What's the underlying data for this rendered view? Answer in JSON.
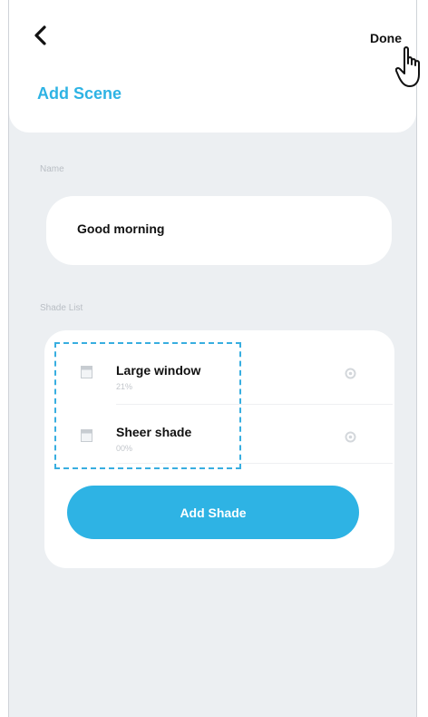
{
  "header": {
    "title": "Add Scene",
    "done_label": "Done",
    "back_icon": "chevron-left-icon",
    "cursor_icon": "hand-pointer-icon"
  },
  "name_section": {
    "label": "Name",
    "value": "Good morning"
  },
  "shade_section": {
    "label": "Shade List",
    "items": [
      {
        "name": "Large window",
        "percent": "21%",
        "icon": "window-shade-icon",
        "action_icon": "settings-icon"
      },
      {
        "name": "Sheer shade",
        "percent": "00%",
        "icon": "window-shade-icon",
        "action_icon": "settings-icon"
      }
    ],
    "add_button_label": "Add Shade"
  },
  "colors": {
    "accent": "#2eb3e4",
    "background": "#eceff2",
    "card": "#ffffff",
    "selection_outline": "#38aee0"
  }
}
